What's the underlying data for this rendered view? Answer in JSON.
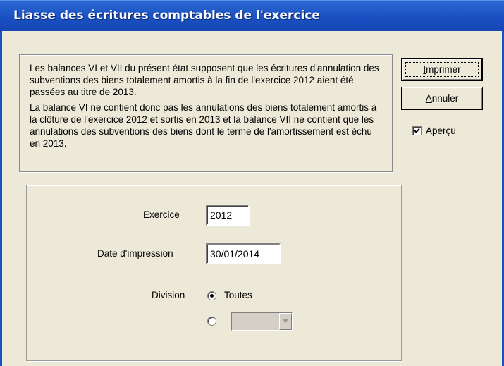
{
  "window": {
    "title": "Liasse des écritures comptables de l'exercice"
  },
  "info": {
    "paragraph1": "Les balances VI et VII du présent état supposent que les écritures d'annulation des subventions des biens totalement amortis à la fin de l'exercice 2012 aient été passées au titre de 2013.",
    "paragraph2": "La balance VI ne contient donc pas les annulations des biens totalement amortis à la clôture de l'exercice 2012 et sortis en 2013 et la balance VII ne contient que les annulations des subventions des biens dont le terme de l'amortissement est échu en 2013."
  },
  "buttons": {
    "print_prefix": "",
    "print_mnemonic": "I",
    "print_rest": "mprimer",
    "cancel_prefix": "",
    "cancel_mnemonic": "A",
    "cancel_rest": "nnuler"
  },
  "preview": {
    "label": "Aperçu",
    "checked": true
  },
  "form": {
    "exercice_label": "Exercice",
    "exercice_value": "2012",
    "date_label": "Date d'impression",
    "date_value": "30/01/2014",
    "division_label": "Division",
    "division_all_label": "Toutes",
    "division_all_selected": true,
    "division_specific_value": ""
  }
}
